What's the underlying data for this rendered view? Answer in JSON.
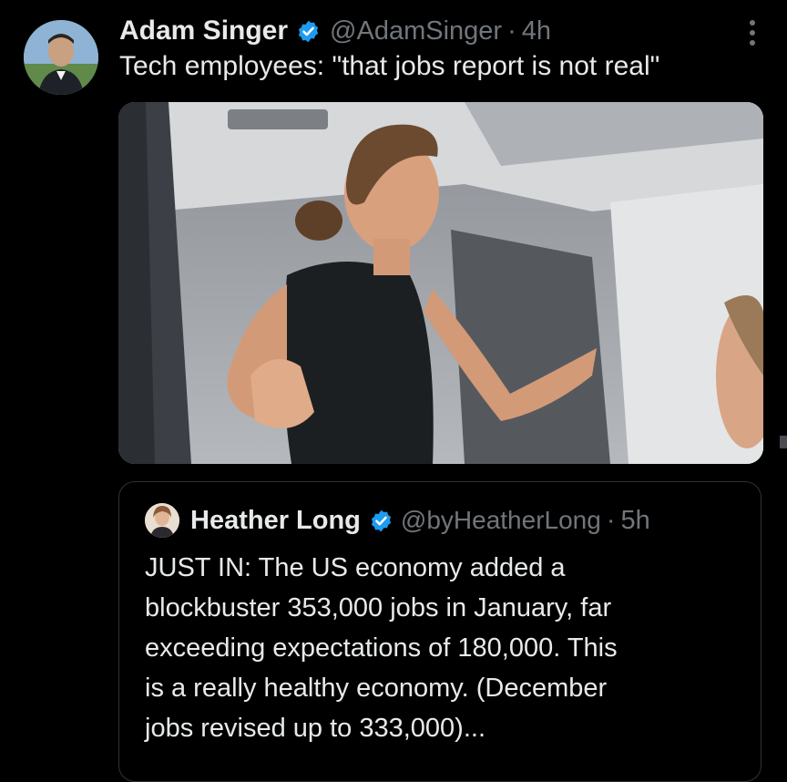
{
  "tweet": {
    "author_name": "Adam Singer",
    "handle": "@AdamSinger",
    "separator": "·",
    "time": "4h",
    "text": "Tech employees: \"that jobs report is not real\"",
    "verified_color": "#1d9bf0",
    "more_icon": "more-vertical-icon"
  },
  "quoted_tweet": {
    "author_name": "Heather Long",
    "handle": "@byHeatherLong",
    "separator": "·",
    "time": "5h",
    "text_lines": [
      "JUST IN: The US economy added a",
      "blockbuster 353,000 jobs in January, far",
      "exceeding expectations of 180,000. This",
      "is a really healthy economy. (December",
      "jobs revised up to 333,000)..."
    ]
  },
  "colors": {
    "background": "#000000",
    "primary_text": "#e7e9ea",
    "secondary_text": "#71767b",
    "border": "#2f3336"
  }
}
